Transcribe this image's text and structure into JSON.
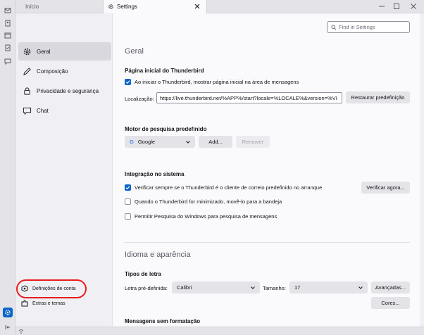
{
  "tabs": {
    "home": "Início",
    "settings": "Settings"
  },
  "search": {
    "placeholder": "Find in Settings"
  },
  "sidebar": {
    "items": [
      {
        "label": "Geral",
        "icon": "gear-icon"
      },
      {
        "label": "Composição",
        "icon": "pen-icon"
      },
      {
        "label": "Privacidade e segurança",
        "icon": "lock-icon"
      },
      {
        "label": "Chat",
        "icon": "chat-icon"
      }
    ],
    "footer": [
      {
        "label": "Definições de conta",
        "icon": "account-settings-icon"
      },
      {
        "label": "Extras e temas",
        "icon": "puzzle-icon"
      }
    ]
  },
  "main": {
    "title": "Geral",
    "start_page": {
      "heading": "Página inicial do Thunderbird",
      "checkbox": "Ao iniciar o Thunderbird, mostrar página inicial na área de mensagens",
      "location_label": "Localização:",
      "location_value": "https://live.thunderbird.net/%APP%/start?locale=%LOCALE%&version=%VI",
      "restore_button": "Restaurar predefinição"
    },
    "search_engine": {
      "heading": "Motor de pesquisa predefinido",
      "selected": "Google",
      "add_button": "Add...",
      "remove_button": "Remover"
    },
    "integration": {
      "heading": "Integração no sistema",
      "check_default": "Verificar sempre se o Thunderbird é o cliente de correio predefinido no arranque",
      "verify_button": "Verificar agora...",
      "minimize_tray": "Quando o Thunderbird for minimizado, movê-lo para a bandeja",
      "windows_search": "Permitir Pesquisa do Windows para pesquisa de mensagens"
    },
    "language": {
      "title": "Idioma e aparência",
      "fonts_heading": "Tipos de letra",
      "default_font_label": "Letra pré-definida:",
      "default_font": "Calibri",
      "size_label": "Tamanho:",
      "size": "17",
      "advanced_button": "Avançadas...",
      "colors_button": "Cores...",
      "plain_heading": "Mensagens sem formatação"
    }
  },
  "colors": {
    "accent": "#0b64c8",
    "highlight_ring": "#e81c1c"
  }
}
